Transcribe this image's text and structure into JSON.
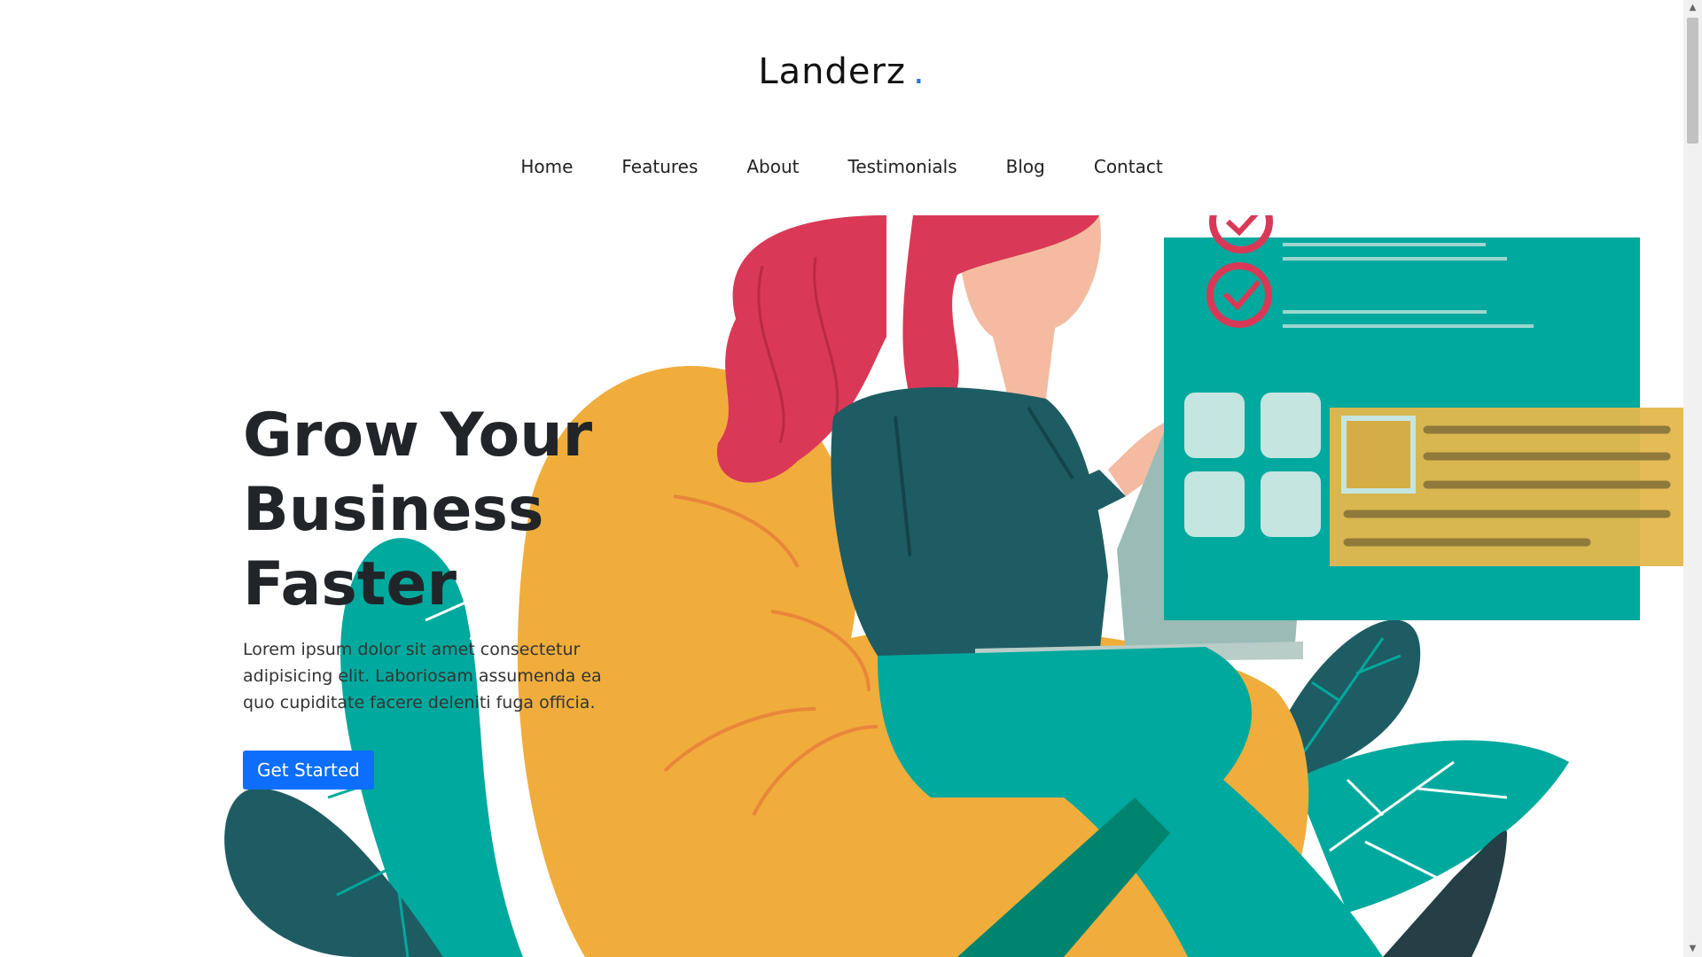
{
  "brand": {
    "name": "Landerz",
    "dot": "."
  },
  "nav": {
    "items": [
      {
        "label": "Home"
      },
      {
        "label": "Features"
      },
      {
        "label": "About"
      },
      {
        "label": "Testimonials"
      },
      {
        "label": "Blog"
      },
      {
        "label": "Contact"
      }
    ]
  },
  "hero": {
    "title": "Grow Your Business Faster",
    "description": "Lorem ipsum dolor sit amet consectetur adipisicing elit. Laboriosam assumenda ea quo cupiditate facere deleniti fuga officia.",
    "cta_label": "Get Started"
  },
  "icons": {
    "scroll_up": "scroll-up-arrow-icon",
    "scroll_down": "scroll-down-arrow-icon"
  },
  "colors": {
    "accent": "#0d6efd",
    "brand_dot": "#1a73e8",
    "teal": "#00a99d",
    "dark_teal": "#1e5c63",
    "yellow": "#f0ad3c",
    "red_hair": "#d93956"
  }
}
